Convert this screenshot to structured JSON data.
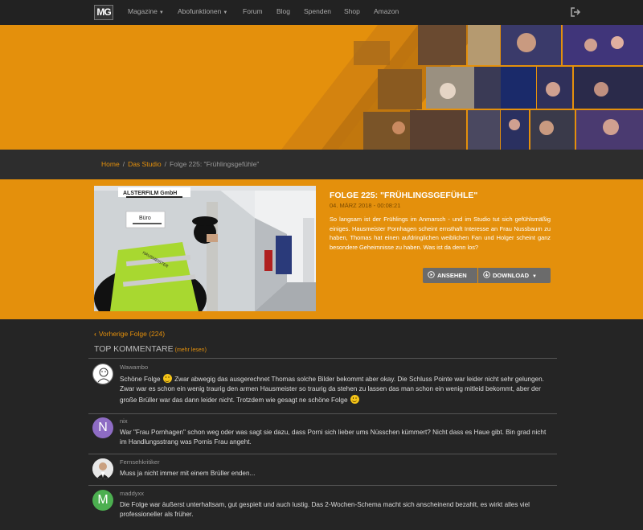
{
  "nav": {
    "logo": "MG",
    "items": [
      {
        "label": "Magazine",
        "dropdown": true
      },
      {
        "label": "Abofunktionen",
        "dropdown": true
      },
      {
        "label": "Forum",
        "dropdown": false
      },
      {
        "label": "Blog",
        "dropdown": false
      },
      {
        "label": "Spenden",
        "dropdown": false
      },
      {
        "label": "Shop",
        "dropdown": false
      },
      {
        "label": "Amazon",
        "dropdown": false
      }
    ],
    "logout_icon": "sign-out-icon"
  },
  "breadcrumb": {
    "home": "Home",
    "studio": "Das Studio",
    "current": "Folge 225: \"Frühlingsgefühle\""
  },
  "episode": {
    "title": "FOLGE 225: \"FRÜHLINGSGEFÜHLE\"",
    "date": "04. MÄRZ 2018 - 00:08:21",
    "description": "So langsam ist der Frühlings im Anmarsch - und im Studio tut sich gefühlsmäßig einiges. Hausmeister Pornhagen scheint ernsthaft Interesse an Frau Nussbaum zu haben, Thomas hat einen aufdringlichen weiblichen Fan und Holger scheint ganz besondere Geheimnisse zu haben. Was ist da denn los?",
    "watch_label": "ANSEHEN",
    "download_label": "DOWNLOAD",
    "thumbnail": {
      "sign_top": "ALSTERFILM GmbH",
      "sign_room": "Büro",
      "vest_text": "HAUSMEISTER"
    }
  },
  "comments_section": {
    "prev_link": "Vorherige Folge (224)",
    "heading": "TOP KOMMENTARE",
    "more_link": "(mehr lesen)",
    "comments": [
      {
        "author": "Wawambo",
        "avatar": "drawing",
        "text1": "Schöne Folge",
        "text2": "Zwar abwegig das ausgerechnet Thomas solche Bilder bekommt aber okay. Die Schluss Pointe war leider nicht sehr gelungen. Zwar war es schon ein wenig traurig den armen Hausmeister so traurig da stehen zu lassen das man schon ein wenig mitleid bekommt, aber der große Brüller war das dann leider nicht. Trotzdem wie gesagt ne schöne Folge"
      },
      {
        "author": "nix",
        "avatar": "N",
        "avatar_color": "#8e6cc4",
        "text": "War \"Frau Pornhagen\" schon weg oder was sagt sie dazu, dass Porni sich lieber ums Nüsschen kümmert? Nicht dass es Haue gibt. Bin grad nicht im Handlungsstrang was Pornis Frau angeht."
      },
      {
        "author": "Fernsehkritiker",
        "avatar": "photo",
        "text": "Muss ja nicht immer mit einem Brüller enden..."
      },
      {
        "author": "maddyxx",
        "avatar": "M",
        "avatar_color": "#4caf50",
        "text": "Die Folge war äußerst unterhaltsam, gut gespielt und auch lustig. Das 2-Wochen-Schema macht sich anscheinend bezahlt, es wirkt alles viel professioneller als früher."
      }
    ]
  },
  "colors": {
    "accent": "#e4900c",
    "navbar": "#222222",
    "content_bg": "#252525",
    "button": "#6b6b6b"
  }
}
